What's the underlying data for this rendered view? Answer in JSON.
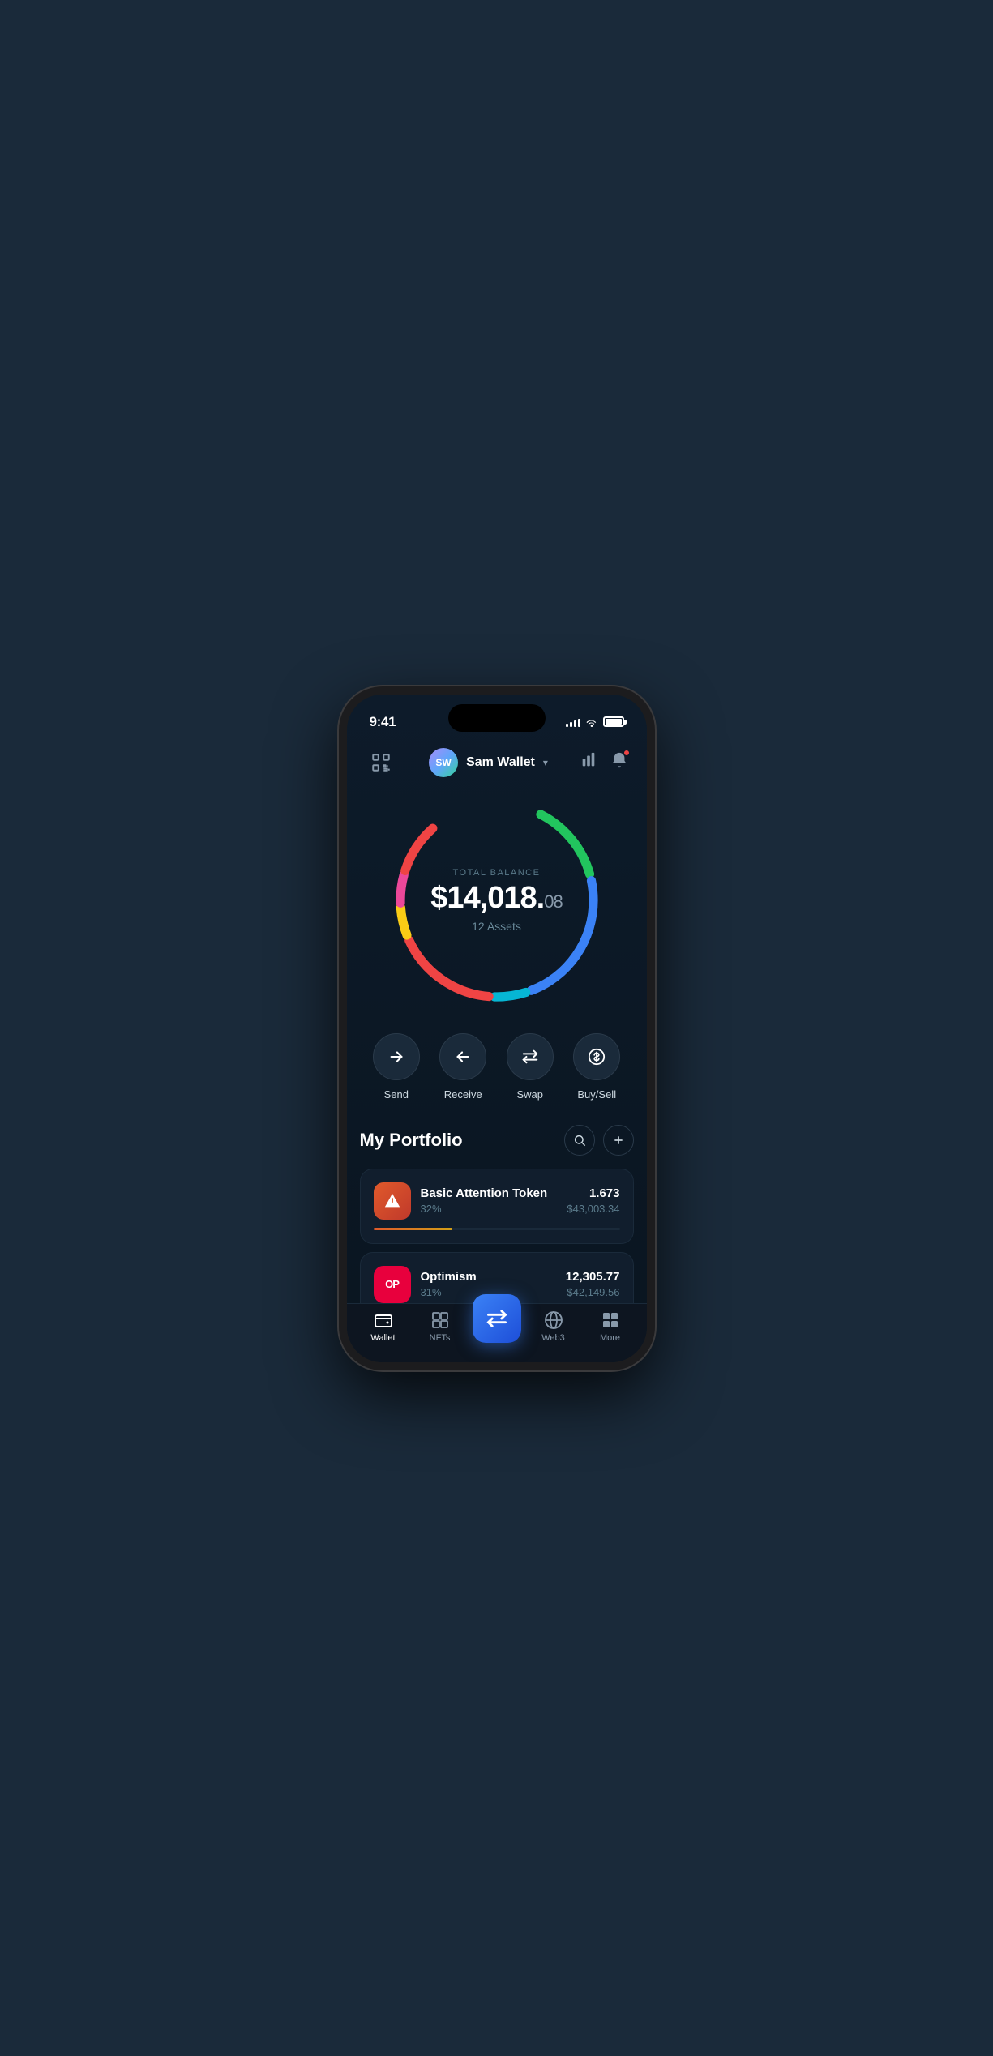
{
  "status_bar": {
    "time": "9:41",
    "battery_level": "100"
  },
  "header": {
    "wallet_icon_label": "scan-icon",
    "user_avatar_initials": "SW",
    "user_name": "Sam Wallet",
    "chevron_label": "▾",
    "chart_icon_label": "chart-icon",
    "bell_icon_label": "bell-icon"
  },
  "balance": {
    "label": "TOTAL BALANCE",
    "main": "$14,018.",
    "cents": "08",
    "assets_label": "12 Assets"
  },
  "actions": [
    {
      "id": "send",
      "label": "Send",
      "icon": "→"
    },
    {
      "id": "receive",
      "label": "Receive",
      "icon": "←"
    },
    {
      "id": "swap",
      "label": "Swap",
      "icon": "⇅"
    },
    {
      "id": "buysell",
      "label": "Buy/Sell",
      "icon": "$"
    }
  ],
  "portfolio": {
    "title": "My Portfolio",
    "search_label": "search",
    "add_label": "add",
    "items": [
      {
        "id": "bat",
        "name": "Basic Attention Token",
        "percent": "32%",
        "amount": "1.673",
        "usd": "$43,003.34",
        "icon_text": "▲",
        "progress": 32,
        "icon_type": "bat"
      },
      {
        "id": "op",
        "name": "Optimism",
        "percent": "31%",
        "amount": "12,305.77",
        "usd": "$42,149.56",
        "icon_text": "OP",
        "progress": 31,
        "icon_type": "op"
      }
    ]
  },
  "bottom_nav": {
    "items": [
      {
        "id": "wallet",
        "label": "Wallet",
        "active": true
      },
      {
        "id": "nfts",
        "label": "NFTs",
        "active": false
      },
      {
        "id": "center",
        "label": "",
        "active": false,
        "is_center": true
      },
      {
        "id": "web3",
        "label": "Web3",
        "active": false
      },
      {
        "id": "more",
        "label": "More",
        "active": false
      }
    ]
  },
  "donut": {
    "segments": [
      {
        "color": "#22c55e",
        "dash": 80,
        "offset": 0
      },
      {
        "color": "#3b82f6",
        "dash": 120,
        "offset": -80
      },
      {
        "color": "#06b6d4",
        "dash": 30,
        "offset": -200
      },
      {
        "color": "#ef4444",
        "dash": 100,
        "offset": -230
      },
      {
        "color": "#facc15",
        "dash": 20,
        "offset": -330
      },
      {
        "color": "#ec4899",
        "dash": 20,
        "offset": -350
      },
      {
        "color": "#ef4444",
        "dash": 30,
        "offset": -370
      }
    ]
  }
}
